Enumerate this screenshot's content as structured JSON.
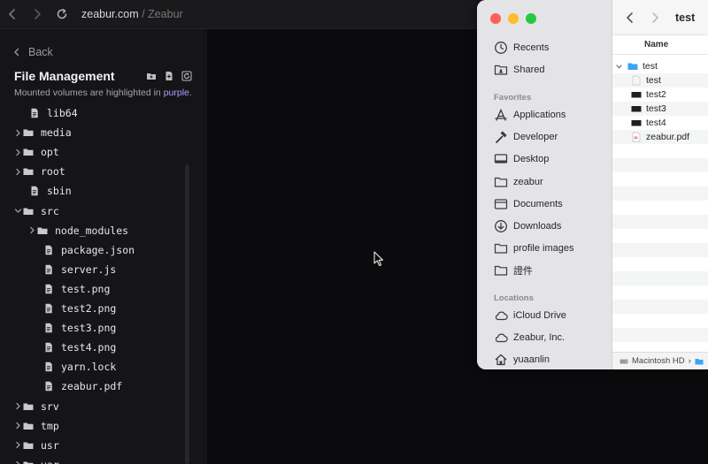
{
  "browser": {
    "url": "zeabur.com",
    "separator": "/",
    "site": "Zeabur"
  },
  "panel": {
    "back_label": "Back",
    "title": "File Management",
    "hint_prefix": "Mounted volumes are highlighted in",
    "hint_highlight": "purple",
    "hint_suffix": ".",
    "tree": [
      {
        "label": "lib64",
        "kind": "file",
        "depth": 1,
        "chevron": "none"
      },
      {
        "label": "media",
        "kind": "folder",
        "depth": 0,
        "chevron": "right"
      },
      {
        "label": "opt",
        "kind": "folder",
        "depth": 0,
        "chevron": "right"
      },
      {
        "label": "root",
        "kind": "folder",
        "depth": 0,
        "chevron": "right"
      },
      {
        "label": "sbin",
        "kind": "file",
        "depth": 1,
        "chevron": "none"
      },
      {
        "label": "src",
        "kind": "folder",
        "depth": 0,
        "chevron": "down"
      },
      {
        "label": "node_modules",
        "kind": "folder",
        "depth": 1,
        "chevron": "right"
      },
      {
        "label": "package.json",
        "kind": "file",
        "depth": 2,
        "chevron": "none"
      },
      {
        "label": "server.js",
        "kind": "file",
        "depth": 2,
        "chevron": "none"
      },
      {
        "label": "test.png",
        "kind": "file",
        "depth": 2,
        "chevron": "none"
      },
      {
        "label": "test2.png",
        "kind": "file",
        "depth": 2,
        "chevron": "none"
      },
      {
        "label": "test3.png",
        "kind": "file",
        "depth": 2,
        "chevron": "none"
      },
      {
        "label": "test4.png",
        "kind": "file",
        "depth": 2,
        "chevron": "none"
      },
      {
        "label": "yarn.lock",
        "kind": "file",
        "depth": 2,
        "chevron": "none"
      },
      {
        "label": "zeabur.pdf",
        "kind": "file",
        "depth": 2,
        "chevron": "none"
      },
      {
        "label": "srv",
        "kind": "folder",
        "depth": 0,
        "chevron": "right"
      },
      {
        "label": "tmp",
        "kind": "folder",
        "depth": 0,
        "chevron": "right"
      },
      {
        "label": "usr",
        "kind": "folder",
        "depth": 0,
        "chevron": "right"
      },
      {
        "label": "var",
        "kind": "folder",
        "depth": 0,
        "chevron": "right"
      }
    ]
  },
  "finder": {
    "title": "test",
    "column_name": "Name",
    "sidebar": {
      "top": [
        {
          "label": "Recents",
          "icon": "clock-icon"
        },
        {
          "label": "Shared",
          "icon": "shared-folder-icon"
        }
      ],
      "favorites_heading": "Favorites",
      "favorites": [
        {
          "label": "Applications",
          "icon": "applications-icon"
        },
        {
          "label": "Developer",
          "icon": "hammer-icon"
        },
        {
          "label": "Desktop",
          "icon": "desktop-icon"
        },
        {
          "label": "zeabur",
          "icon": "folder-icon"
        },
        {
          "label": "Documents",
          "icon": "document-icon"
        },
        {
          "label": "Downloads",
          "icon": "download-icon"
        },
        {
          "label": "profile images",
          "icon": "folder-icon"
        },
        {
          "label": "證件",
          "icon": "folder-icon"
        }
      ],
      "locations_heading": "Locations",
      "locations": [
        {
          "label": "iCloud Drive",
          "icon": "cloud-icon"
        },
        {
          "label": "Zeabur, Inc.",
          "icon": "cloud-icon"
        },
        {
          "label": "yuaanlin",
          "icon": "home-icon"
        }
      ]
    },
    "files": [
      {
        "label": "test",
        "kind": "folder",
        "expanded": true,
        "indent": 0
      },
      {
        "label": "test",
        "kind": "blank",
        "indent": 1
      },
      {
        "label": "test2",
        "kind": "image",
        "indent": 1
      },
      {
        "label": "test3",
        "kind": "image",
        "indent": 1
      },
      {
        "label": "test4",
        "kind": "image",
        "indent": 1
      },
      {
        "label": "zeabur.pdf",
        "kind": "pdf",
        "indent": 1
      }
    ],
    "path": "Macintosh HD",
    "path_sep": "›"
  }
}
